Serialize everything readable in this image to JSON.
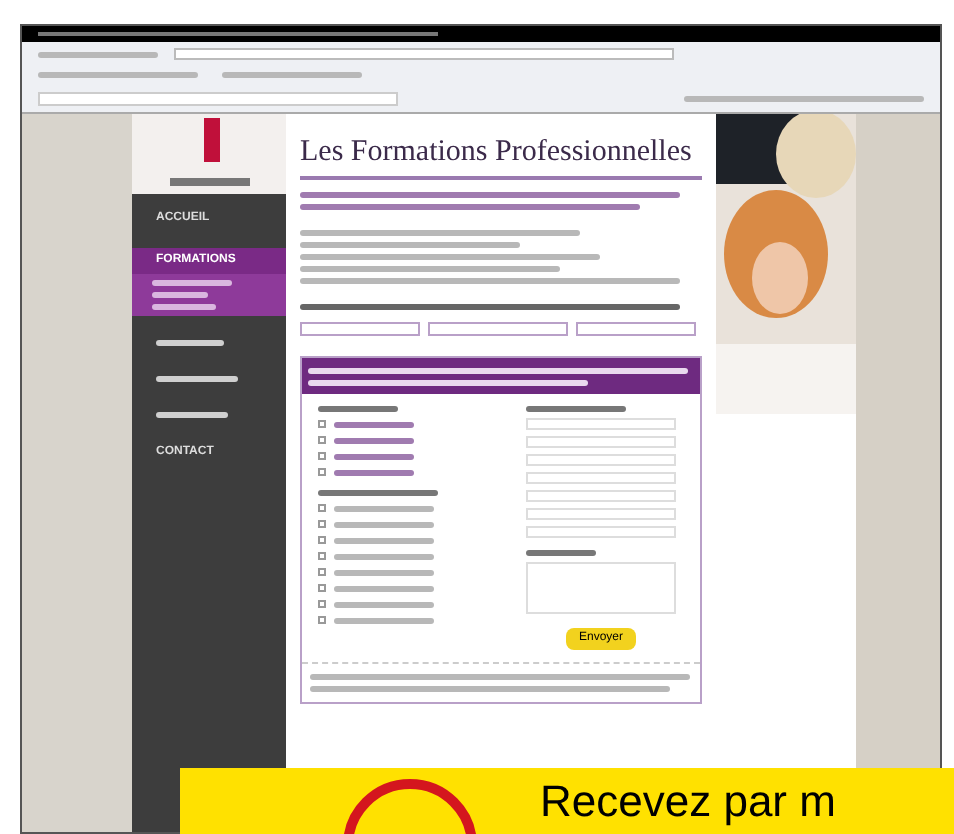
{
  "page": {
    "title": "Les Formations Professionnelles"
  },
  "nav": [
    {
      "label": "ACCUEIL",
      "selected": false
    },
    {
      "label": "FORMATIONS",
      "selected": true
    },
    {
      "selected": false
    },
    {
      "selected": false
    },
    {
      "selected": false
    },
    {
      "label": "CONTACT",
      "selected": false
    }
  ],
  "form": {
    "submit": "Envoyer",
    "options": [
      {
        "checked": false
      },
      {
        "checked": false
      },
      {
        "checked": false
      },
      {
        "checked": false
      }
    ],
    "modules": [
      {
        "checked": false
      },
      {
        "checked": false
      },
      {
        "checked": false
      },
      {
        "checked": false
      },
      {
        "checked": false
      },
      {
        "checked": false
      },
      {
        "checked": false
      },
      {
        "checked": false
      }
    ]
  },
  "banner": {
    "text": "Recevez par m"
  }
}
